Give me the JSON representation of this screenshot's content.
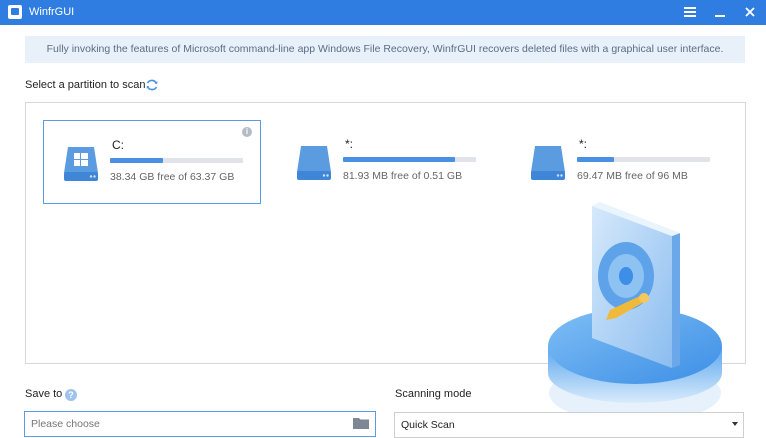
{
  "window": {
    "title": "WinfrGUI",
    "menu_icon": "hamburger-icon",
    "minimize_icon": "minimize-icon",
    "close_icon": "close-icon"
  },
  "banner": {
    "text": "Fully invoking the features of Microsoft command-line app Windows File Recovery, WinfrGUI recovers deleted files with a graphical user interface."
  },
  "partitions_section": {
    "label": "Select a partition to scan",
    "refresh_icon": "refresh-icon"
  },
  "partitions": [
    {
      "name": "C:",
      "free_text": "38.34 GB free of 63.37 GB",
      "used_fraction": 0.4,
      "selected": true,
      "icon": "windows-drive-icon"
    },
    {
      "name": "*:",
      "free_text": "81.93 MB free of 0.51 GB",
      "used_fraction": 0.84,
      "selected": false,
      "icon": "drive-icon"
    },
    {
      "name": "*:",
      "free_text": "69.47 MB free of 96 MB",
      "used_fraction": 0.28,
      "selected": false,
      "icon": "drive-icon"
    }
  ],
  "save_to": {
    "label": "Save to",
    "placeholder": "Please choose",
    "help_icon": "help-icon",
    "folder_icon": "folder-icon"
  },
  "scanning_mode": {
    "label": "Scanning mode",
    "selected": "Quick Scan"
  },
  "colors": {
    "titlebar": "#2f7de1",
    "accent": "#4a90e2",
    "banner_bg": "#e8f0fa"
  }
}
